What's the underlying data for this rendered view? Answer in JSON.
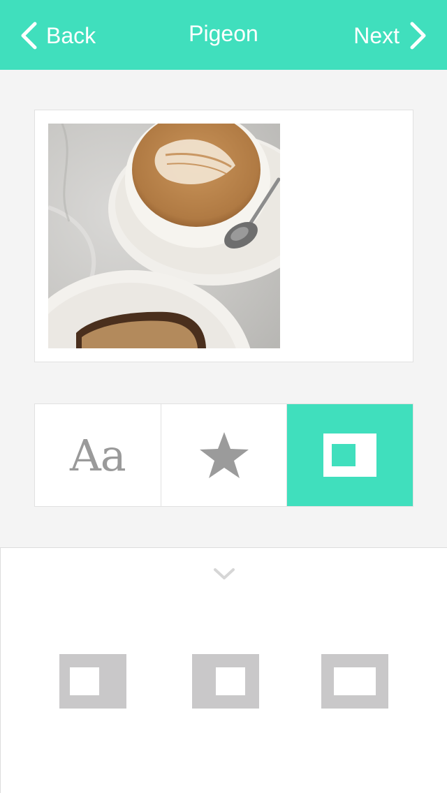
{
  "navbar": {
    "back_label": "Back",
    "title": "Pigeon",
    "next_label": "Next",
    "back_icon": "chevron-left-icon",
    "next_icon": "chevron-right-icon",
    "accent_color": "#40dfbd"
  },
  "preview": {
    "photo_icon": "photo-coffee-latte"
  },
  "tools": {
    "tabs": [
      {
        "label": "Aa",
        "icon": "text-icon",
        "active": false
      },
      {
        "label": "",
        "icon": "star-icon",
        "active": false
      },
      {
        "label": "",
        "icon": "frame-icon",
        "active": true
      }
    ]
  },
  "frames_panel": {
    "collapse_icon": "chevron-down-icon",
    "options": [
      {
        "icon": "frame-square-small-icon"
      },
      {
        "icon": "frame-square-centered-icon"
      },
      {
        "icon": "frame-wide-icon"
      }
    ],
    "option_color": "#c9c8c9"
  }
}
